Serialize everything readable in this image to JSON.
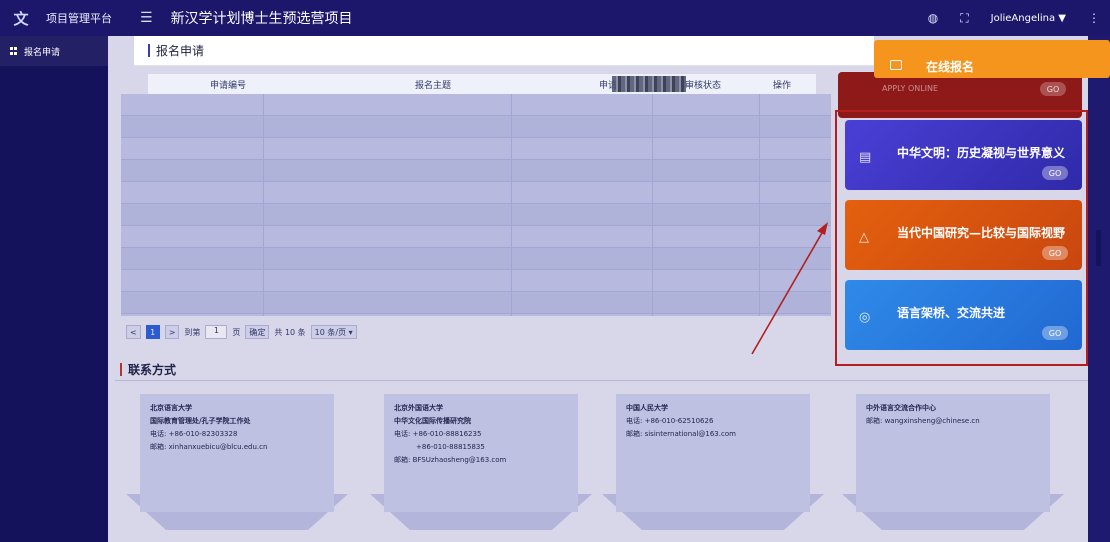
{
  "header": {
    "app_name": "项目管理平台",
    "menu_icon": "hamburger-icon",
    "project_title": "新汉学计划博士生预选营项目",
    "user": "JolieAngelina ▼",
    "icons": [
      "palette-icon",
      "fullscreen-icon",
      "more-icon"
    ]
  },
  "sidebar": {
    "items": [
      {
        "label": "报名申请",
        "icon": "grid-icon"
      }
    ]
  },
  "main": {
    "breadcrumb": "报名申请",
    "table": {
      "columns": [
        "申请编号",
        "报名主题",
        "申请",
        "审核状态",
        "操作"
      ],
      "rows": []
    },
    "pager": {
      "prev": "<",
      "current": "1",
      "next": ">",
      "goto_label": "到第",
      "goto_value": "1",
      "page_unit": "页",
      "confirm": "确定",
      "total": "共 10 条",
      "page_size": "10 条/页 ▾"
    }
  },
  "contact": {
    "title": "联系方式",
    "cards": [
      {
        "org": "北京语言大学",
        "dept": "国际教育管理处/孔子学院工作处",
        "lines": [
          "电话: +86-010-82303328",
          "邮箱: xinhanxuebicu@blcu.edu.cn"
        ]
      },
      {
        "org": "北京外国语大学",
        "dept": "中华文化国际传播研究院",
        "lines": [
          "电话: +86-010-88816235",
          "+86-010-88815835",
          "邮箱: BFSUzhaosheng@163.com"
        ]
      },
      {
        "org": "中国人民大学",
        "dept": "",
        "lines": [
          "电话: +86-010-62510626",
          "邮箱: sisinternational@163.com"
        ]
      },
      {
        "org": "中外语言交流合作中心",
        "dept": "",
        "lines": [
          "邮箱: wangxinsheng@chinese.cn"
        ]
      }
    ]
  },
  "apply_panel": {
    "banner": "在线报名",
    "top_tile_sub": "APPLY ONLINE",
    "go": "GO",
    "tiles": [
      {
        "title": "中华文明：历史凝视与世界意义",
        "color": "#3f38c9",
        "icon": "document-icon"
      },
      {
        "title": "当代中国研究—比较与国际视野",
        "color": "#d8560f",
        "icon": "mountain-icon"
      },
      {
        "title": "语言架桥、交流共进",
        "color": "#2a7fe0",
        "icon": "globe-icon"
      }
    ]
  },
  "colors": {
    "header": "#1c176b",
    "banner": "#f5951e",
    "highlight_frame": "#b31e1e",
    "pager_active": "#2d62d9"
  }
}
